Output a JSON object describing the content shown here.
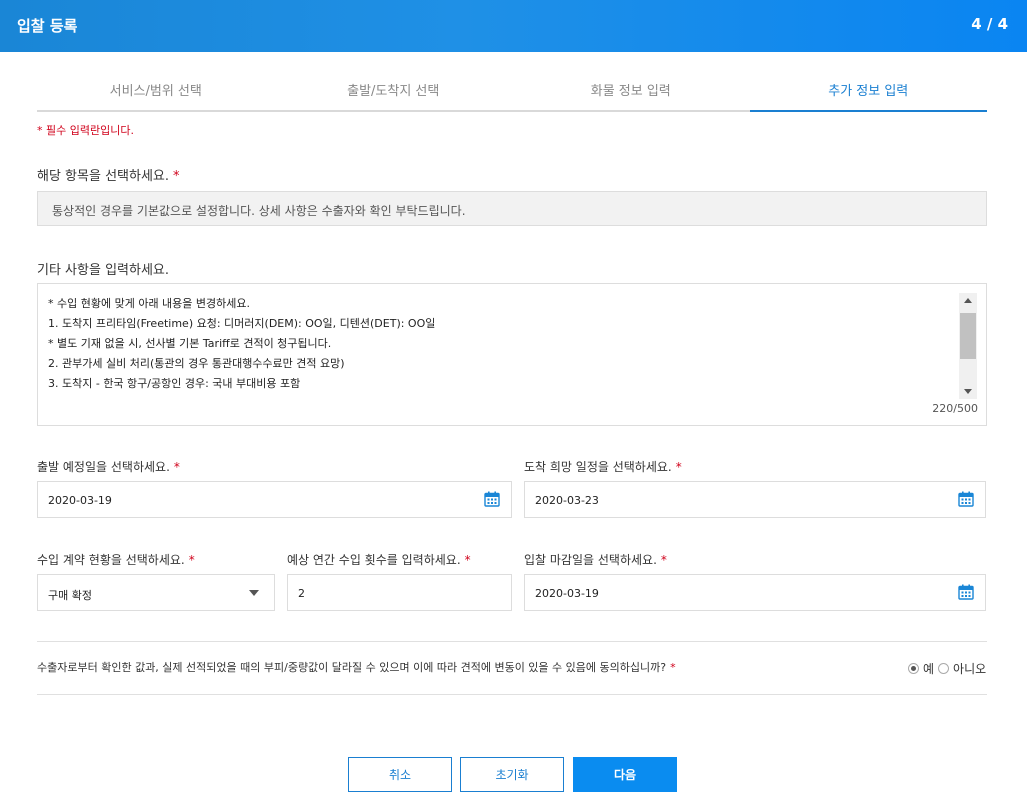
{
  "header": {
    "title": "입찰 등록",
    "step": "4 / 4"
  },
  "tabs": [
    {
      "label": "서비스/범위 선택",
      "active": false
    },
    {
      "label": "출발/도착지 선택",
      "active": false
    },
    {
      "label": "화물 정보 입력",
      "active": false
    },
    {
      "label": "추가 정보 입력",
      "active": true
    }
  ],
  "required_note": "* 필수 입력란입니다.",
  "select_item": {
    "label": "해당 항목을 선택하세요.",
    "value": "통상적인 경우를 기본값으로 설정합니다. 상세 사항은 수출자와 확인 부탁드립니다."
  },
  "other": {
    "label": "기타 사항을 입력하세요.",
    "lines": [
      "* 수입 현황에 맞게 아래 내용을 변경하세요.",
      "1. 도착지 프리타임(Freetime) 요청: 디머러지(DEM): OO일, 디텐션(DET): OO일",
      "* 별도 기재 없을 시, 선사별 기본 Tariff로 견적이 청구됩니다.",
      "2. 관부가세 실비 처리(통관의 경우 통관대행수수료만 견적 요망)",
      "3. 도착지 - 한국 항구/공항인 경우: 국내 부대비용 포함"
    ],
    "counter": "220/500"
  },
  "departure": {
    "label": "출발 예정일을 선택하세요.",
    "value": "2020-03-19"
  },
  "arrival": {
    "label": "도착 희망 일정을 선택하세요.",
    "value": "2020-03-23"
  },
  "contract": {
    "label": "수입 계약 현황을 선택하세요.",
    "value": "구매 확정"
  },
  "count": {
    "label": "예상 연간 수입 횟수를 입력하세요.",
    "value": "2"
  },
  "deadline": {
    "label": "입찰 마감일을 선택하세요.",
    "value": "2020-03-19"
  },
  "agreement": {
    "question": "수출자로부터 확인한 값과, 실제 선적되었을 때의 부피/중량값이 달라질 수 있으며 이에 따라 견적에 변동이 있을 수 있음에 동의하십니까?",
    "yes": "예",
    "no": "아니오",
    "selected": "yes"
  },
  "buttons": {
    "cancel": "취소",
    "reset": "초기화",
    "next": "다음"
  },
  "colors": {
    "accent": "#1a7fd1",
    "required": "#d0021b",
    "header": "#1f8ee8"
  }
}
